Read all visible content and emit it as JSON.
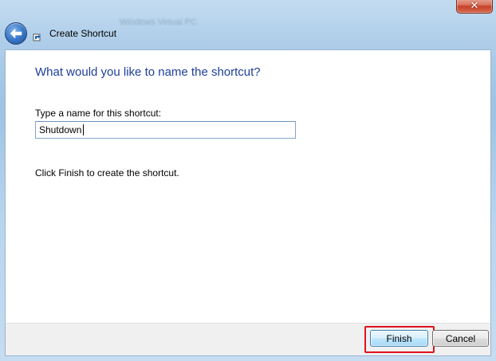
{
  "window": {
    "close_glyph": "✕",
    "background_title": "Windows Virtual PC"
  },
  "nav": {
    "back_icon": "back-arrow-icon",
    "shortcut_icon": "shortcut-overlay-icon",
    "title": "Create Shortcut"
  },
  "main": {
    "heading": "What would you like to name the shortcut?",
    "name_label": "Type a name for this shortcut:",
    "name_value": "Shutdown",
    "finish_hint": "Click Finish to create the shortcut."
  },
  "footer": {
    "finish_label": "Finish",
    "cancel_label": "Cancel",
    "highlight_color": "#e0141e"
  },
  "colors": {
    "heading": "#1e3f9a",
    "frame": "#aecde9",
    "close": "#c4432a"
  }
}
